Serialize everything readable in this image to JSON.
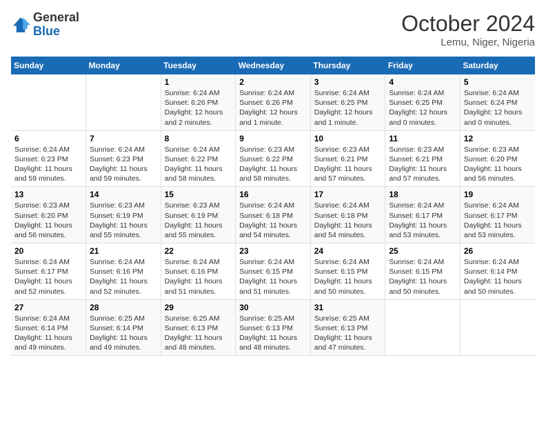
{
  "header": {
    "logo_line1": "General",
    "logo_line2": "Blue",
    "month_year": "October 2024",
    "location": "Lemu, Niger, Nigeria"
  },
  "columns": [
    "Sunday",
    "Monday",
    "Tuesday",
    "Wednesday",
    "Thursday",
    "Friday",
    "Saturday"
  ],
  "weeks": [
    [
      {
        "day": "",
        "text": ""
      },
      {
        "day": "",
        "text": ""
      },
      {
        "day": "1",
        "text": "Sunrise: 6:24 AM\nSunset: 6:26 PM\nDaylight: 12 hours and 2 minutes."
      },
      {
        "day": "2",
        "text": "Sunrise: 6:24 AM\nSunset: 6:26 PM\nDaylight: 12 hours and 1 minute."
      },
      {
        "day": "3",
        "text": "Sunrise: 6:24 AM\nSunset: 6:25 PM\nDaylight: 12 hours and 1 minute."
      },
      {
        "day": "4",
        "text": "Sunrise: 6:24 AM\nSunset: 6:25 PM\nDaylight: 12 hours and 0 minutes."
      },
      {
        "day": "5",
        "text": "Sunrise: 6:24 AM\nSunset: 6:24 PM\nDaylight: 12 hours and 0 minutes."
      }
    ],
    [
      {
        "day": "6",
        "text": "Sunrise: 6:24 AM\nSunset: 6:23 PM\nDaylight: 11 hours and 59 minutes."
      },
      {
        "day": "7",
        "text": "Sunrise: 6:24 AM\nSunset: 6:23 PM\nDaylight: 11 hours and 59 minutes."
      },
      {
        "day": "8",
        "text": "Sunrise: 6:24 AM\nSunset: 6:22 PM\nDaylight: 11 hours and 58 minutes."
      },
      {
        "day": "9",
        "text": "Sunrise: 6:23 AM\nSunset: 6:22 PM\nDaylight: 11 hours and 58 minutes."
      },
      {
        "day": "10",
        "text": "Sunrise: 6:23 AM\nSunset: 6:21 PM\nDaylight: 11 hours and 57 minutes."
      },
      {
        "day": "11",
        "text": "Sunrise: 6:23 AM\nSunset: 6:21 PM\nDaylight: 11 hours and 57 minutes."
      },
      {
        "day": "12",
        "text": "Sunrise: 6:23 AM\nSunset: 6:20 PM\nDaylight: 11 hours and 56 minutes."
      }
    ],
    [
      {
        "day": "13",
        "text": "Sunrise: 6:23 AM\nSunset: 6:20 PM\nDaylight: 11 hours and 56 minutes."
      },
      {
        "day": "14",
        "text": "Sunrise: 6:23 AM\nSunset: 6:19 PM\nDaylight: 11 hours and 55 minutes."
      },
      {
        "day": "15",
        "text": "Sunrise: 6:23 AM\nSunset: 6:19 PM\nDaylight: 11 hours and 55 minutes."
      },
      {
        "day": "16",
        "text": "Sunrise: 6:24 AM\nSunset: 6:18 PM\nDaylight: 11 hours and 54 minutes."
      },
      {
        "day": "17",
        "text": "Sunrise: 6:24 AM\nSunset: 6:18 PM\nDaylight: 11 hours and 54 minutes."
      },
      {
        "day": "18",
        "text": "Sunrise: 6:24 AM\nSunset: 6:17 PM\nDaylight: 11 hours and 53 minutes."
      },
      {
        "day": "19",
        "text": "Sunrise: 6:24 AM\nSunset: 6:17 PM\nDaylight: 11 hours and 53 minutes."
      }
    ],
    [
      {
        "day": "20",
        "text": "Sunrise: 6:24 AM\nSunset: 6:17 PM\nDaylight: 11 hours and 52 minutes."
      },
      {
        "day": "21",
        "text": "Sunrise: 6:24 AM\nSunset: 6:16 PM\nDaylight: 11 hours and 52 minutes."
      },
      {
        "day": "22",
        "text": "Sunrise: 6:24 AM\nSunset: 6:16 PM\nDaylight: 11 hours and 51 minutes."
      },
      {
        "day": "23",
        "text": "Sunrise: 6:24 AM\nSunset: 6:15 PM\nDaylight: 11 hours and 51 minutes."
      },
      {
        "day": "24",
        "text": "Sunrise: 6:24 AM\nSunset: 6:15 PM\nDaylight: 11 hours and 50 minutes."
      },
      {
        "day": "25",
        "text": "Sunrise: 6:24 AM\nSunset: 6:15 PM\nDaylight: 11 hours and 50 minutes."
      },
      {
        "day": "26",
        "text": "Sunrise: 6:24 AM\nSunset: 6:14 PM\nDaylight: 11 hours and 50 minutes."
      }
    ],
    [
      {
        "day": "27",
        "text": "Sunrise: 6:24 AM\nSunset: 6:14 PM\nDaylight: 11 hours and 49 minutes."
      },
      {
        "day": "28",
        "text": "Sunrise: 6:25 AM\nSunset: 6:14 PM\nDaylight: 11 hours and 49 minutes."
      },
      {
        "day": "29",
        "text": "Sunrise: 6:25 AM\nSunset: 6:13 PM\nDaylight: 11 hours and 48 minutes."
      },
      {
        "day": "30",
        "text": "Sunrise: 6:25 AM\nSunset: 6:13 PM\nDaylight: 11 hours and 48 minutes."
      },
      {
        "day": "31",
        "text": "Sunrise: 6:25 AM\nSunset: 6:13 PM\nDaylight: 11 hours and 47 minutes."
      },
      {
        "day": "",
        "text": ""
      },
      {
        "day": "",
        "text": ""
      }
    ]
  ]
}
